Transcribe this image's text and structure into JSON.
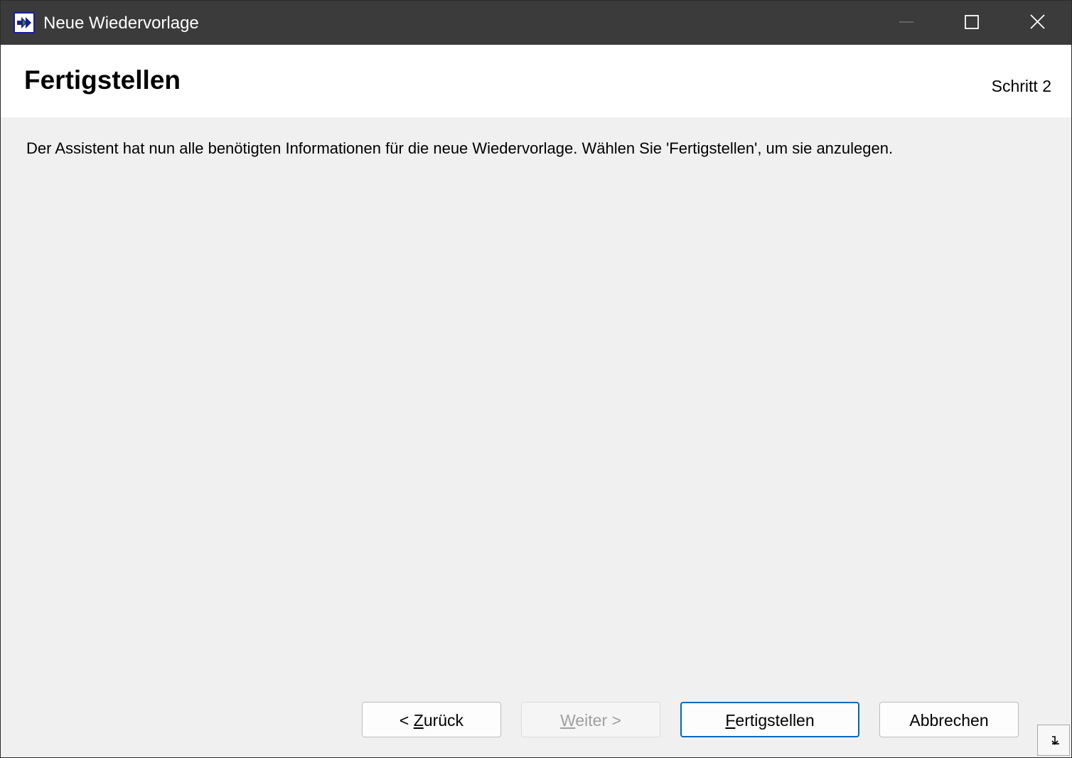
{
  "window": {
    "title": "Neue Wiedervorlage",
    "icon": "double-arrow-icon"
  },
  "header": {
    "title": "Fertigstellen",
    "step": "Schritt 2"
  },
  "content": {
    "message": "Der Assistent hat nun alle benötigten Informationen für die neue Wiedervorlage. Wählen Sie 'Fertigstellen', um sie anzulegen."
  },
  "buttons": {
    "back_prefix": "< ",
    "back_mnemonic": "Z",
    "back_rest": "urück",
    "next_mnemonic": "W",
    "next_rest": "eiter >",
    "finish_mnemonic": "F",
    "finish_rest": "ertigstellen",
    "cancel": "Abbrechen"
  },
  "colors": {
    "titlebar": "#3b3b3b",
    "accent": "#0067c0",
    "icon_blue": "#1c1c9c",
    "icon_green": "#1ea000"
  }
}
